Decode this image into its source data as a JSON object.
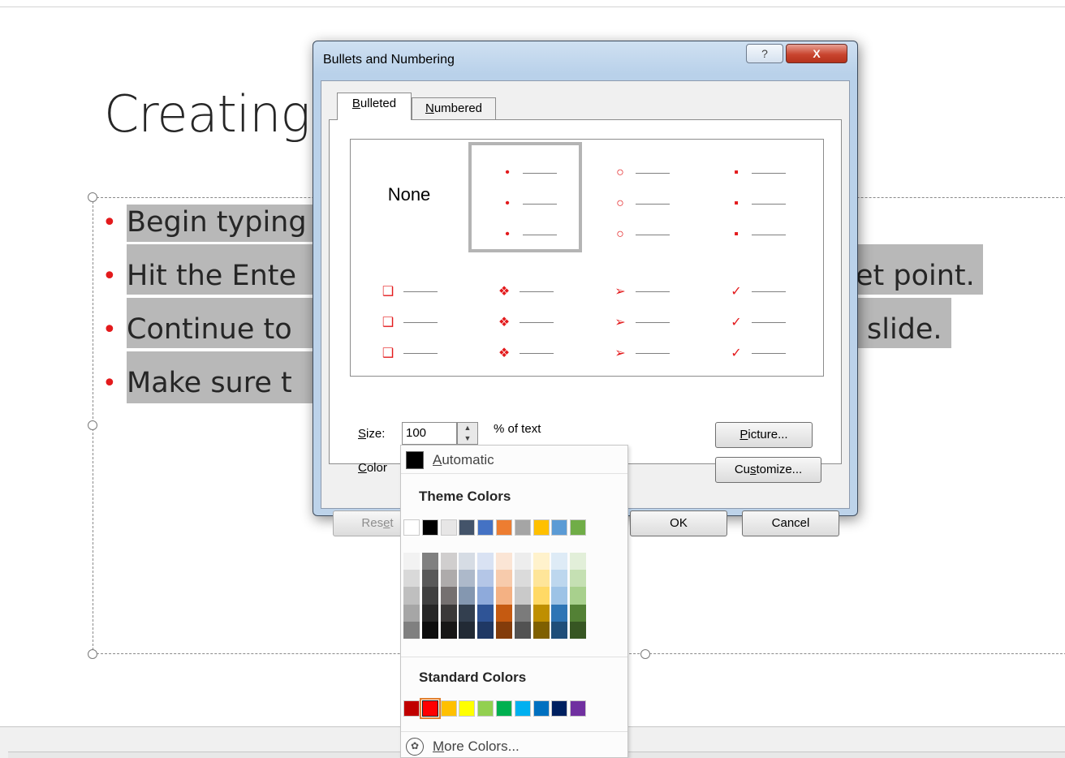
{
  "slide": {
    "title": "Creating",
    "bullets": [
      "Begin typing",
      "Hit the Ente",
      "Continue to",
      "Make sure t"
    ],
    "bullet_tails": [
      "et point.",
      "slide."
    ],
    "bullet_color": "#e31a1c"
  },
  "dialog": {
    "title": "Bullets and Numbering",
    "help_glyph": "?",
    "close_glyph": "X",
    "tabs": [
      {
        "accel": "B",
        "rest": "ulleted"
      },
      {
        "accel": "N",
        "rest": "umbered"
      }
    ],
    "gallery": {
      "none_label": "None",
      "styles": [
        {
          "name": "none"
        },
        {
          "name": "small-dot",
          "glyph": "•"
        },
        {
          "name": "hollow-circle",
          "glyph": "○"
        },
        {
          "name": "filled-square",
          "glyph": "▪"
        },
        {
          "name": "hollow-square",
          "glyph": "❑"
        },
        {
          "name": "four-diamonds",
          "glyph": "❖"
        },
        {
          "name": "arrowhead",
          "glyph": "➢"
        },
        {
          "name": "checkmark",
          "glyph": "✓"
        }
      ],
      "selected_index": 1
    },
    "size": {
      "accel": "S",
      "rest": "ize:",
      "value": "100",
      "unit": "% of text"
    },
    "color": {
      "accel": "C",
      "rest": "olor",
      "current": "#e31a1c"
    },
    "buttons": {
      "picture": {
        "accel": "P",
        "rest": "icture..."
      },
      "customize": {
        "pre": "Cu",
        "accel": "s",
        "rest": "tomize..."
      },
      "reset": {
        "pre": "Res",
        "accel": "e",
        "rest": "t"
      },
      "ok": "OK",
      "cancel": "Cancel"
    }
  },
  "color_dropdown": {
    "automatic": {
      "accel": "A",
      "rest": "utomatic"
    },
    "theme_title": "Theme Colors",
    "theme_colors": [
      "#ffffff",
      "#000000",
      "#e7e6e6",
      "#44546a",
      "#4472c4",
      "#ed7d31",
      "#a5a5a5",
      "#ffc000",
      "#5b9bd5",
      "#70ad47"
    ],
    "theme_shades": [
      [
        "#f2f2f2",
        "#d9d9d9",
        "#bfbfbf",
        "#a6a6a6",
        "#808080"
      ],
      [
        "#808080",
        "#595959",
        "#404040",
        "#262626",
        "#0d0d0d"
      ],
      [
        "#d0cece",
        "#aeabab",
        "#757070",
        "#3a3838",
        "#171616"
      ],
      [
        "#d6dce4",
        "#adb9ca",
        "#8497b0",
        "#333f4f",
        "#222a35"
      ],
      [
        "#d9e2f3",
        "#b4c6e7",
        "#8eaadb",
        "#2f5496",
        "#1f3864"
      ],
      [
        "#fbe5d5",
        "#f7cbac",
        "#f4b183",
        "#c55a11",
        "#833c0b"
      ],
      [
        "#ededed",
        "#dbdbdb",
        "#c9c9c9",
        "#7b7b7b",
        "#525252"
      ],
      [
        "#fff2cc",
        "#fee599",
        "#ffd965",
        "#bf8f00",
        "#7f6000"
      ],
      [
        "#deebf6",
        "#bdd7ee",
        "#9dc3e6",
        "#2e75b5",
        "#1f4e79"
      ],
      [
        "#e2efd9",
        "#c5e0b3",
        "#a8d08d",
        "#538135",
        "#375623"
      ]
    ],
    "standard_title": "Standard Colors",
    "standard_colors": [
      "#c00000",
      "#ff0000",
      "#ffc000",
      "#ffff00",
      "#92d050",
      "#00b050",
      "#00b0f0",
      "#0070c0",
      "#002060",
      "#7030a0"
    ],
    "standard_selected_index": 1,
    "more_colors": {
      "accel": "M",
      "rest": "ore Colors..."
    }
  }
}
